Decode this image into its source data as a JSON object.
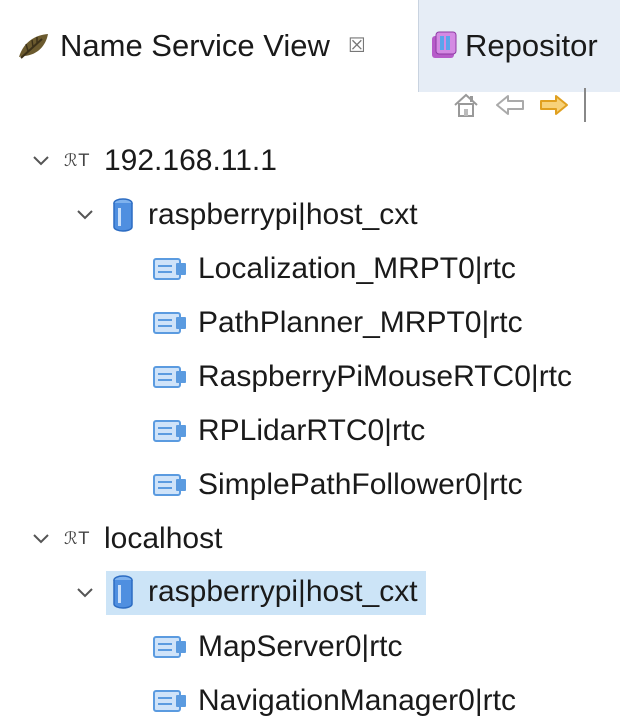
{
  "tabs": {
    "active": {
      "title": "Name Service View",
      "icon": "leaf-icon",
      "close": "☒"
    },
    "inactive": {
      "title": "Repositor",
      "icon": "repository-icon"
    }
  },
  "toolbar": {
    "buttons": [
      {
        "name": "home-icon"
      },
      {
        "name": "back-arrow-icon"
      },
      {
        "name": "forward-arrow-icon"
      }
    ]
  },
  "tree": {
    "hosts": [
      {
        "label": "192.168.11.1",
        "host_icon": "ℛT",
        "contexts": [
          {
            "label": "raspberrypi|host_cxt",
            "selected": false,
            "components": [
              "Localization_MRPT0|rtc",
              "PathPlanner_MRPT0|rtc",
              "RaspberryPiMouseRTC0|rtc",
              "RPLidarRTC0|rtc",
              "SimplePathFollower0|rtc"
            ]
          }
        ]
      },
      {
        "label": "localhost",
        "host_icon": "ℛT",
        "contexts": [
          {
            "label": "raspberrypi|host_cxt",
            "selected": true,
            "components": [
              "MapServer0|rtc",
              "NavigationManager0|rtc"
            ]
          }
        ]
      }
    ]
  },
  "colors": {
    "selection": "#cce4f7",
    "inactive_tab": "#e6edf6",
    "context_icon": "#3d7fd6",
    "rtc_icon": "#5b9be0",
    "forward_arrow": "#f2b035"
  }
}
